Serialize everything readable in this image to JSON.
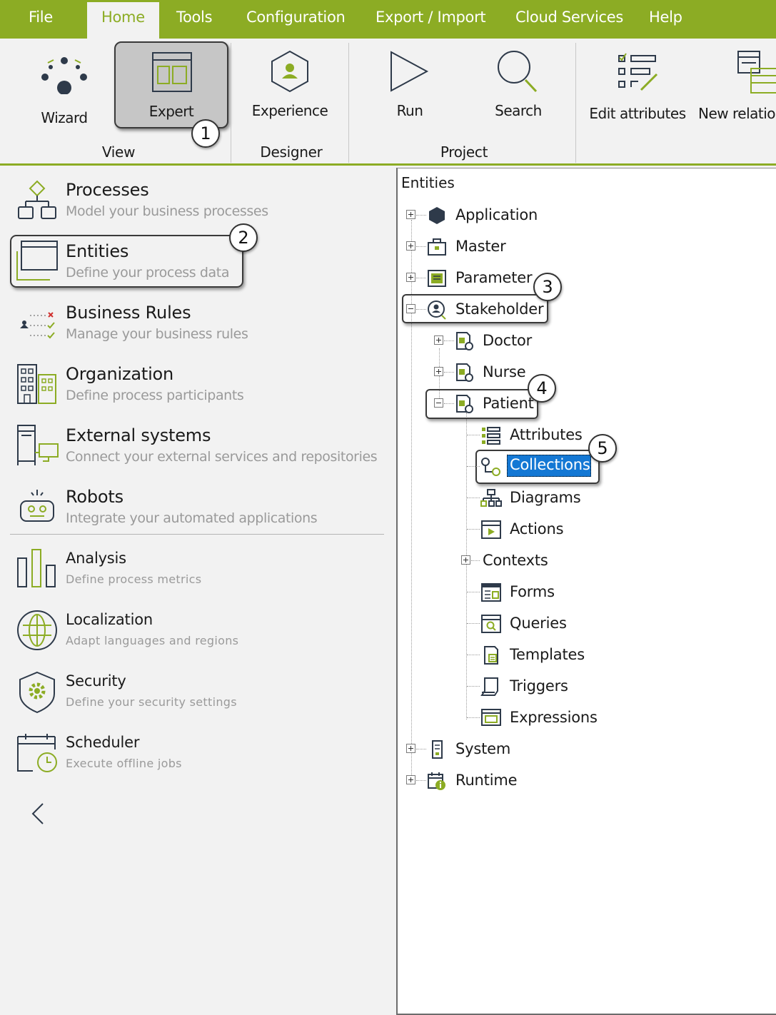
{
  "menu": {
    "items": [
      {
        "label": "File"
      },
      {
        "label": "Home"
      },
      {
        "label": "Tools"
      },
      {
        "label": "Configuration"
      },
      {
        "label": "Export / Import"
      },
      {
        "label": "Cloud Services"
      },
      {
        "label": "Help"
      }
    ],
    "active": "Home"
  },
  "ribbon": {
    "wizard": "Wizard",
    "expert": "Expert",
    "experience": "Experience",
    "run": "Run",
    "search": "Search",
    "edit_attributes": "Edit attributes",
    "new_relation": "New relatio",
    "groups": {
      "view": "View",
      "designer": "Designer",
      "project": "Project"
    }
  },
  "callouts": [
    "1",
    "2",
    "3",
    "4",
    "5"
  ],
  "left_panel": {
    "items": [
      {
        "title": "Processes",
        "subtitle": "Model your business processes"
      },
      {
        "title": "Entities",
        "subtitle": "Define your process data"
      },
      {
        "title": "Business Rules",
        "subtitle": "Manage your business rules"
      },
      {
        "title": "Organization",
        "subtitle": "Define process participants"
      },
      {
        "title": "External systems",
        "subtitle": "Connect your external services and repositories"
      },
      {
        "title": "Robots",
        "subtitle": "Integrate your automated applications"
      },
      {
        "title": "Analysis",
        "subtitle": "Define  process  metrics"
      },
      {
        "title": "Localization",
        "subtitle": "Adapt  languages  and  regions"
      },
      {
        "title": "Security",
        "subtitle": "Define  your  security  settings"
      },
      {
        "title": "Scheduler",
        "subtitle": "Execute  offline  jobs"
      }
    ]
  },
  "tree": {
    "root": "Entities",
    "nodes": {
      "application": "Application",
      "master": "Master",
      "parameter": "Parameter",
      "stakeholder": "Stakeholder",
      "doctor": "Doctor",
      "nurse": "Nurse",
      "patient": "Patient",
      "attributes": "Attributes",
      "collections": "Collections",
      "diagrams": "Diagrams",
      "actions": "Actions",
      "contexts": "Contexts",
      "forms": "Forms",
      "queries": "Queries",
      "templates": "Templates",
      "triggers": "Triggers",
      "expressions": "Expressions",
      "system": "System",
      "runtime": "Runtime"
    },
    "selected": "Collections"
  },
  "colors": {
    "accent": "#8cac24",
    "selection": "#1478d4",
    "icon_dark": "#2e3a4a"
  }
}
